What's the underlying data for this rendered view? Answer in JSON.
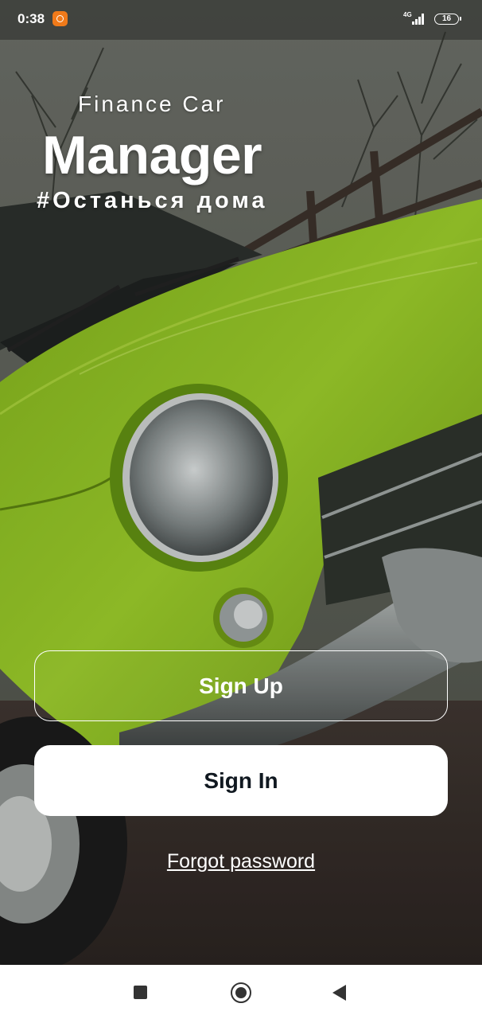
{
  "status_bar": {
    "time": "0:38",
    "network": "4G",
    "battery": "16"
  },
  "header": {
    "subtitle": "Finance Car",
    "title": "Manager",
    "tagline": "#Останься дома"
  },
  "actions": {
    "sign_up_label": "Sign Up",
    "sign_in_label": "Sign In",
    "forgot_password_label": "Forgot password"
  },
  "colors": {
    "accent_car": "#8fc21a",
    "signin_background": "#ffffff",
    "signin_text": "#101820",
    "text_primary": "#ffffff",
    "notification_icon": "#f07a1a"
  },
  "nav_icons": [
    "recent-apps-icon",
    "home-icon",
    "back-icon"
  ]
}
